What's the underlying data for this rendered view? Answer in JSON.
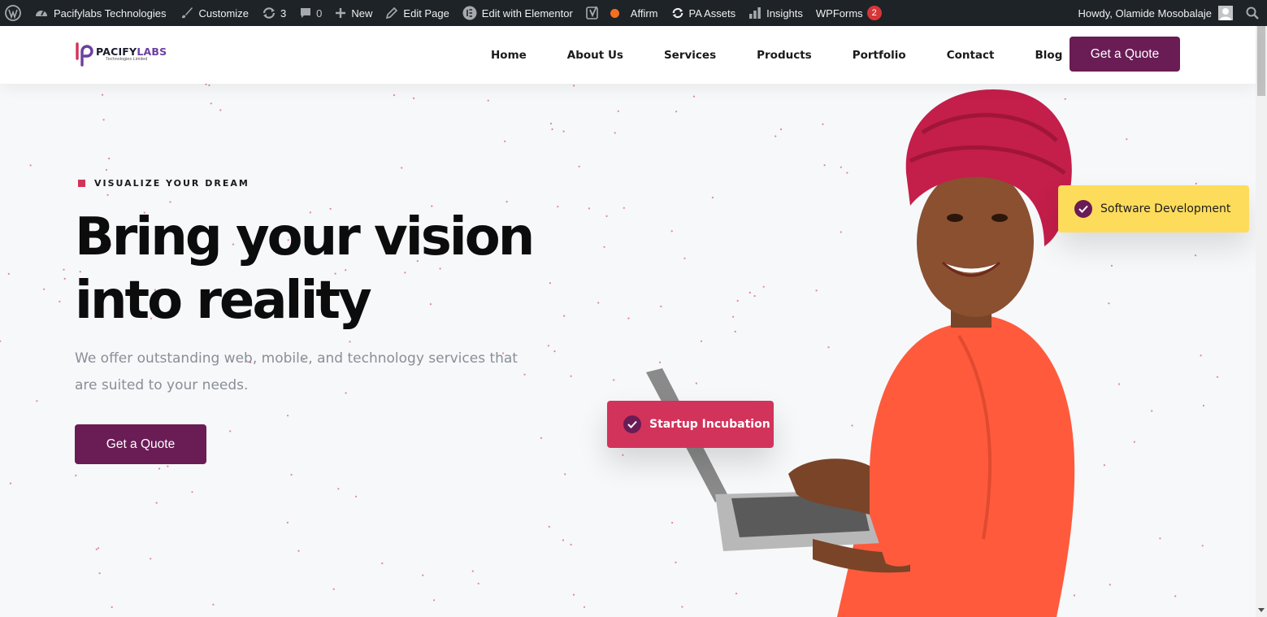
{
  "admin_bar": {
    "site_name": "Pacifylabs Technologies",
    "customize": "Customize",
    "updates_count": "3",
    "comments_count": "0",
    "new": "New",
    "edit_page": "Edit Page",
    "edit_elementor": "Edit with Elementor",
    "affirm": "Affirm",
    "pa_assets": "PA Assets",
    "insights": "Insights",
    "wpforms": "WPForms",
    "wpforms_badge": "2",
    "greeting": "Howdy, Olamide Mosobalaje"
  },
  "header": {
    "logo_name_a": "PACIFY",
    "logo_name_b": "LABS",
    "logo_sub": "Technologies Limited",
    "nav": [
      "Home",
      "About Us",
      "Services",
      "Products",
      "Portfolio",
      "Contact",
      "Blog"
    ],
    "cta": "Get a Quote"
  },
  "hero": {
    "eyebrow": "VISUALIZE YOUR DREAM",
    "headline_a": "Bring your ",
    "headline_highlight": "vision",
    "headline_b": "into reality",
    "subtext": "We offer outstanding web, mobile, and technology services that are suited to your needs.",
    "cta": "Get a Quote",
    "card_dev": "Software Development",
    "card_inc": "Startup Incubation"
  },
  "colors": {
    "admin_bg": "#1d2327",
    "brand_purple": "#6a1c55",
    "accent_pink": "#d2335a",
    "accent_yellow": "#fddc5c"
  },
  "icons": {
    "wp": "wordpress-icon",
    "dashboard": "dashboard-icon",
    "brush": "brush-icon",
    "updates": "refresh-icon",
    "comments": "comment-icon",
    "plus": "plus-icon",
    "pencil": "pencil-icon",
    "elementor": "elementor-icon",
    "yoast": "yoast-icon",
    "insights": "bar-chart-icon",
    "search": "search-icon",
    "check": "check-icon"
  }
}
